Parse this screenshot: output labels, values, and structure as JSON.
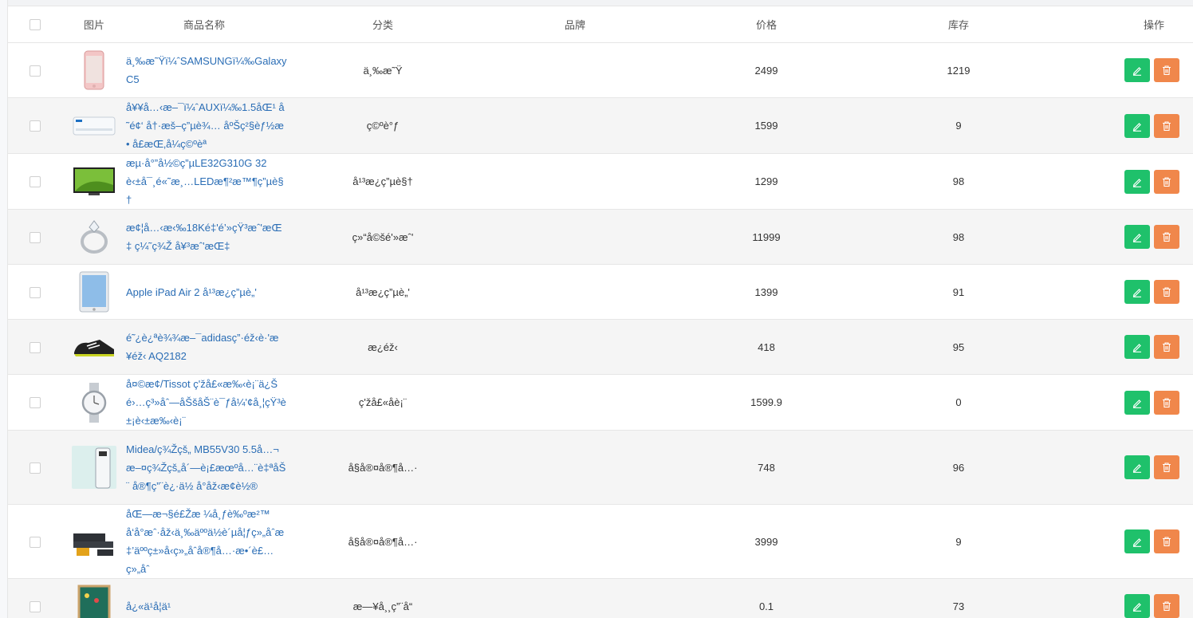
{
  "colors": {
    "edit_button": "#1fc16b",
    "delete_button": "#f0874b",
    "link": "#2a6db5",
    "stripe": "#f5f5f5"
  },
  "table": {
    "headers": {
      "image": "图片",
      "name": "商品名称",
      "category": "分类",
      "brand": "品牌",
      "price": "价格",
      "stock": "库存",
      "actions": "操作"
    },
    "rows": [
      {
        "name": "ä¸‰æ˜Ÿï¼ˆSAMSUNGï¼‰Galaxy C5",
        "category": "ä¸‰æ˜Ÿ",
        "brand": "",
        "price": "2499",
        "stock": "1219",
        "image_icon": "pink-phone-image"
      },
      {
        "name": "å¥¥å…‹æ–¯ï¼ˆAUXï¼‰1.5åŒ¹ å˜é¢‘ å†·æš–ç”µè¾… åºŠç²§èƒ½æ• å£æŒ‚å¼ç©ºèª",
        "category": "ç©ºè°ƒ",
        "brand": "",
        "price": "1599",
        "stock": "9",
        "image_icon": "air-conditioner-image"
      },
      {
        "name": "æµ·å°”å½©ç”µLE32G310G 32è‹±å¯¸é«˜æ¸…LEDæ¶²æ™¶ç”µè§†",
        "category": "å¹³æ¿ç”µè§†",
        "brand": "",
        "price": "1299",
        "stock": "98",
        "image_icon": "television-image"
      },
      {
        "name": "æ¢¦å…‹æ‹‰18Ké‡'é’»çŸ³æˆ'æŒ‡ ç¼˜ç¾Ž å¥³æˆ'æŒ‡",
        "category": "ç»“å©šé'»æˆ'",
        "brand": "",
        "price": "11999",
        "stock": "98",
        "image_icon": "diamond-ring-image"
      },
      {
        "name": "Apple iPad Air 2 å¹³æ¿ç”µè„'",
        "category": "å¹³æ¿ç”µè„'",
        "brand": "",
        "price": "1399",
        "stock": "91",
        "image_icon": "tablet-image"
      },
      {
        "name": "é˜¿è¿ªè¾¾æ–¯adidasç”·éž‹è·'æ¥éž‹ AQ2182",
        "category": "æ¿éž‹",
        "brand": "",
        "price": "418",
        "stock": "95",
        "image_icon": "sneaker-image"
      },
      {
        "name": "å¤©æ¢­/Tissot ç'žå£«æ‰‹è¡¨ä¿Šé›…ç³»åˆ—åŠšåŠ¨è¯ƒå¼'¢å¸¦çŸ³è±¡è‹±æ‰‹è¡¨",
        "category": "ç'žå£«åè¡¨",
        "brand": "",
        "price": "1599.9",
        "stock": "0",
        "image_icon": "wristwatch-image"
      },
      {
        "name": "Midea/ç¾Žçš„ MB55V30 5.5å…¬æ–¤ç¾Žçš„å´—è¡£æœºå…¨è‡ªåŠ¨ å®¶ç”¨è¿·ä½ å°åž‹æ¢è½®",
        "category": "å§å®¤å®¶å…·",
        "brand": "",
        "price": "748",
        "stock": "96",
        "image_icon": "washing-machine-image"
      },
      {
        "name": "åŒ—æ¬§é£Žæ ¼å¸ƒè‰ºæ²™å‘å°æˆ·åž‹ä¸‰äººä½è´µå¦ƒç»„åˆæ‡’äººç±»å‹ç»„åˆå®¶å…·æ•´è£…ç»„åˆ",
        "category": "å§å®¤å®¶å…·",
        "brand": "",
        "price": "3999",
        "stock": "9",
        "image_icon": "sofa-image"
      },
      {
        "name": "å¿«ä¹å¦ä¹",
        "category": "æ—¥å¸¸ç”¨å“",
        "brand": "",
        "price": "0.1",
        "stock": "73",
        "image_icon": "toy-board-image"
      }
    ]
  }
}
